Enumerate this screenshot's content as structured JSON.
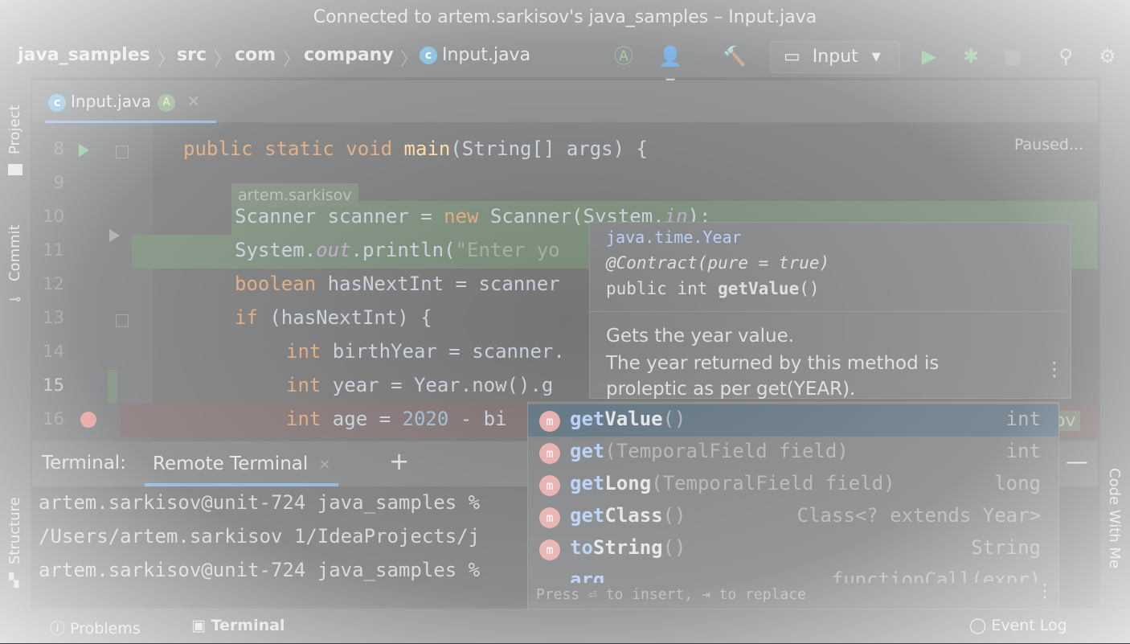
{
  "window": {
    "title": "Connected to artem.sarkisov's java_samples – Input.java"
  },
  "breadcrumb": [
    "java_samples",
    "src",
    "com",
    "company",
    "Input.java"
  ],
  "toolbar": {
    "run_config": "Input"
  },
  "left_tools": {
    "project": "Project",
    "commit": "Commit",
    "structure": "Structure"
  },
  "right_tools": {
    "code_with_me": "Code With Me"
  },
  "tabs": [
    {
      "label": "Input.java",
      "badge": "A"
    }
  ],
  "editor": {
    "paused": "Paused...",
    "author_tag": "artem.sarkisov",
    "author_tag_right": "ov",
    "lines": [
      {
        "num": "8"
      },
      {
        "num": "9"
      },
      {
        "num": "10"
      },
      {
        "num": "11"
      },
      {
        "num": "12"
      },
      {
        "num": "13"
      },
      {
        "num": "14"
      },
      {
        "num": "15"
      },
      {
        "num": "16"
      }
    ],
    "code": {
      "l8_a": "public static void ",
      "l8_fn": "main",
      "l8_b": "(String[] args) {",
      "l10_a": "Scanner scanner = ",
      "l10_kw": "new",
      "l10_b": " Scanner(System.",
      "l10_stat": "in",
      "l10_c": ");",
      "l11_a": "System.",
      "l11_stat": "out",
      "l11_b": ".println(",
      "l11_str": "\"Enter yo",
      "l12_kw": "boolean",
      "l12_b": " hasNextInt = scanner",
      "l13_kw": "if",
      "l13_b": " (hasNextInt) {",
      "l14_kw": "int",
      "l14_b": " birthYear = scanner.",
      "l15_kw": "int",
      "l15_b": " year = Year.now().g",
      "l16_kw": "int",
      "l16_b": " age = ",
      "l16_num": "2020",
      "l16_c": " - bi"
    }
  },
  "doc_popup": {
    "class_name": "java.time.Year",
    "annotation": "@Contract(pure = true)",
    "signature_prefix": "public int ",
    "signature_method": "getValue",
    "signature_suffix": "()",
    "desc_1": "Gets the year value.",
    "desc_2": "The year returned by this method is",
    "desc_3": "proleptic as per get(YEAR)."
  },
  "completion": {
    "items": [
      {
        "icon": "m",
        "match": "get",
        "rest": "Value",
        "params": "()",
        "type": "int"
      },
      {
        "icon": "m",
        "match": "get",
        "rest": "",
        "params": "(TemporalField field)",
        "type": "int"
      },
      {
        "icon": "m",
        "match": "get",
        "rest": "Long",
        "params": "(TemporalField field)",
        "type": "long"
      },
      {
        "icon": "m",
        "match": "get",
        "rest": "Class",
        "params": "()",
        "type": "Class<? extends Year>"
      },
      {
        "icon": "m",
        "match": "to",
        "rest": "String",
        "params": "()",
        "type": "String"
      },
      {
        "icon": "",
        "match": "arg",
        "rest": "",
        "params": "",
        "type": "functionCall(expr)"
      }
    ],
    "hint": "Press ⏎ to insert, ⇥ to replace"
  },
  "terminal": {
    "label": "Terminal:",
    "tab": "Remote Terminal",
    "lines": [
      "artem.sarkisov@unit-724 java_samples %",
      "/Users/artem.sarkisov 1/IdeaProjects/j",
      "artem.sarkisov@unit-724 java_samples %"
    ]
  },
  "bottom_bar": {
    "problems": "Problems",
    "terminal": "Terminal",
    "event_log": "Event Log"
  }
}
